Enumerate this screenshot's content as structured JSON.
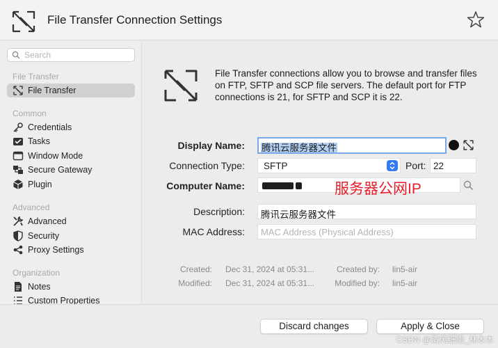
{
  "window": {
    "title": "File Transfer Connection Settings",
    "title_icon": "file-transfer-icon",
    "favorite_icon": "star-icon"
  },
  "sidebar": {
    "search_placeholder": "Search",
    "sections": [
      {
        "header": "File Transfer",
        "items": [
          {
            "label": "File Transfer",
            "icon": "file-transfer-icon",
            "selected": true
          }
        ]
      },
      {
        "header": "Common",
        "items": [
          {
            "label": "Credentials",
            "icon": "key-icon"
          },
          {
            "label": "Tasks",
            "icon": "tasks-icon"
          },
          {
            "label": "Window Mode",
            "icon": "window-icon"
          },
          {
            "label": "Secure Gateway",
            "icon": "gateway-icon"
          },
          {
            "label": "Plugin",
            "icon": "plugin-icon"
          }
        ]
      },
      {
        "header": "Advanced",
        "items": [
          {
            "label": "Advanced",
            "icon": "tools-icon"
          },
          {
            "label": "Security",
            "icon": "shield-icon"
          },
          {
            "label": "Proxy Settings",
            "icon": "proxy-icon"
          }
        ]
      },
      {
        "header": "Organization",
        "items": [
          {
            "label": "Notes",
            "icon": "notes-icon"
          },
          {
            "label": "Custom Properties",
            "icon": "list-icon"
          }
        ]
      }
    ]
  },
  "main": {
    "intro": "File Transfer connections allow you to browse and transfer files on FTP, SFTP and SCP file servers. The default port for FTP connections is 21, for SFTP and SCP it is 22.",
    "display_name_label": "Display Name:",
    "display_name_value": "腾讯云服务器文件",
    "connection_type_label": "Connection Type:",
    "connection_type_value": "SFTP",
    "port_label": "Port:",
    "port_value": "22",
    "computer_name_label": "Computer Name:",
    "computer_name_overlay": "服务器公网IP",
    "description_label": "Description:",
    "description_value": "腾讯云服务器文件",
    "mac_label": "MAC Address:",
    "mac_placeholder": "MAC Address (Physical Address)",
    "created_label": "Created:",
    "created_value": "Dec 31, 2024 at 05:31...",
    "created_by_label": "Created by:",
    "created_by_value": "lin5-air",
    "modified_label": "Modified:",
    "modified_value": "Dec 31, 2024 at 05:31...",
    "modified_by_label": "Modified by:",
    "modified_by_value": "lin5-air"
  },
  "footer": {
    "discard_label": "Discard changes",
    "apply_label": "Apply & Close"
  },
  "watermark": "CSDN @清风细雨_林木木",
  "colors": {
    "accent": "#3478f6",
    "focus_ring": "#7aa7e8",
    "selection": "#b4d1f4",
    "annotation": "#e5202a"
  }
}
